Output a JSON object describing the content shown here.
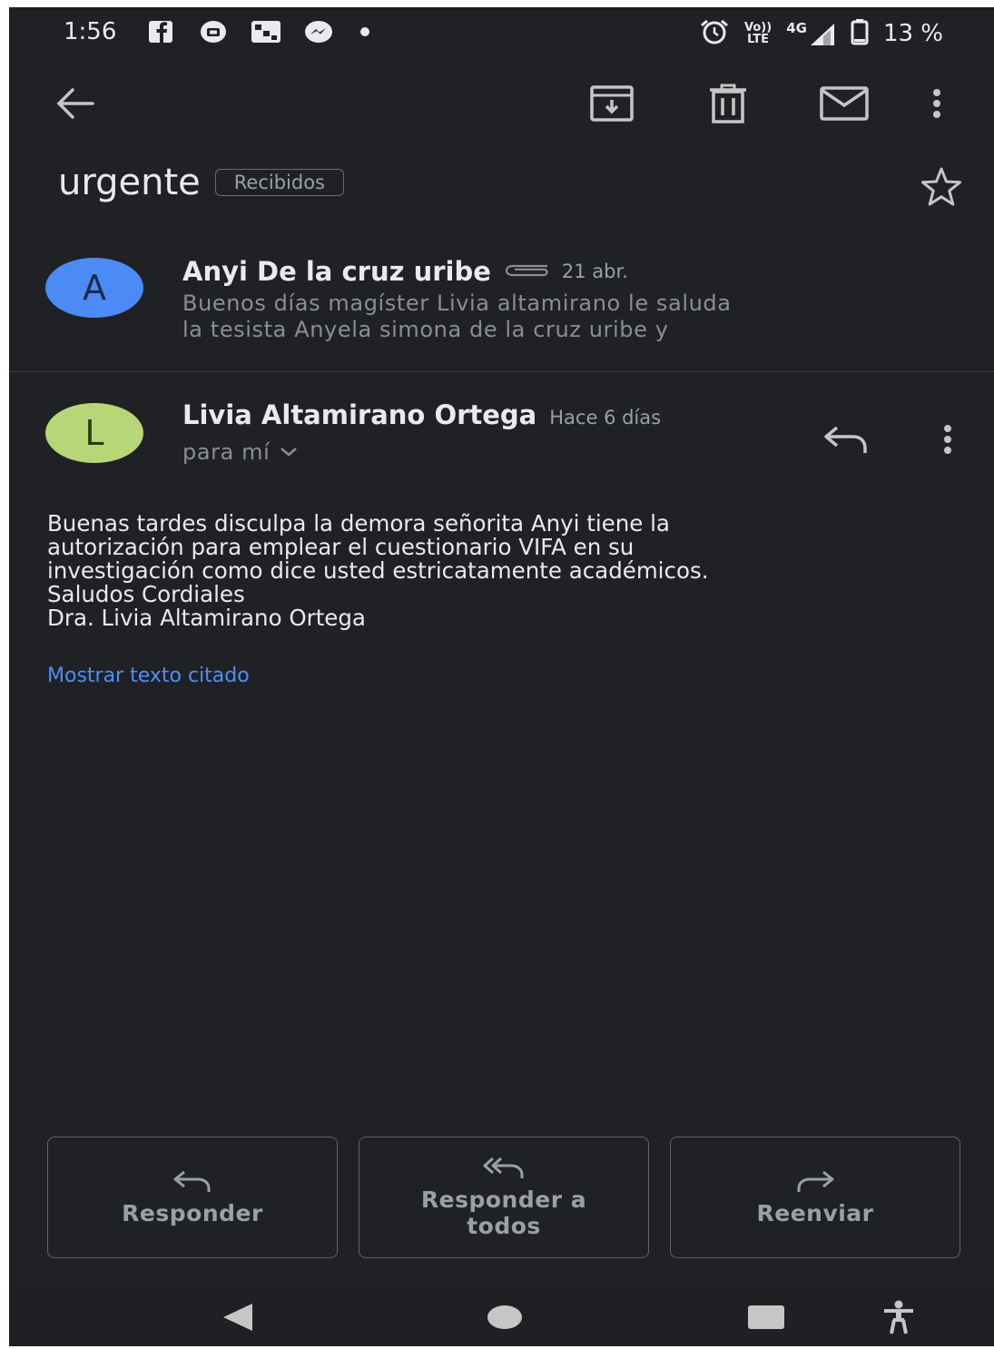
{
  "status_bar": {
    "time": "1:56",
    "battery": "13 %",
    "network": "4G",
    "volte_top": "Vo))",
    "volte_bottom": "LTE"
  },
  "toolbar": {
    "back_icon": "arrow-left-icon",
    "archive_icon": "archive-icon",
    "delete_icon": "trash-icon",
    "mark_unread_icon": "envelope-icon",
    "more_icon": "more-vert-icon"
  },
  "thread": {
    "subject": "urgente",
    "label": "Recibidos"
  },
  "messages": [
    {
      "avatar_letter": "A",
      "sender": "Anyi De la cruz uribe",
      "date": "21 abr.",
      "snippet_line1": "Buenos días magíster Livia altamirano le saluda",
      "snippet_line2": "la tesista Anyela simona de la cruz uribe y"
    },
    {
      "avatar_letter": "L",
      "sender": "Livia Altamirano Ortega",
      "date": "Hace 6 días",
      "recipient": "para mí",
      "body_lines": [
        "Buenas tardes disculpa la demora señorita Anyi tiene la",
        "autorización para emplear el cuestionario VIFA en su",
        "investigación como dice usted estricatamente académicos.",
        "Saludos Cordiales",
        "Dra. Livia Altamirano Ortega"
      ],
      "show_quoted": "Mostrar texto citado"
    }
  ],
  "actions": {
    "reply": "Responder",
    "reply_all": "Responder a todos",
    "forward": "Reenviar"
  },
  "colors": {
    "background": "#202124",
    "avatar_a": "#4c8bf5",
    "avatar_l": "#b7d677",
    "link": "#4f8ff7"
  }
}
